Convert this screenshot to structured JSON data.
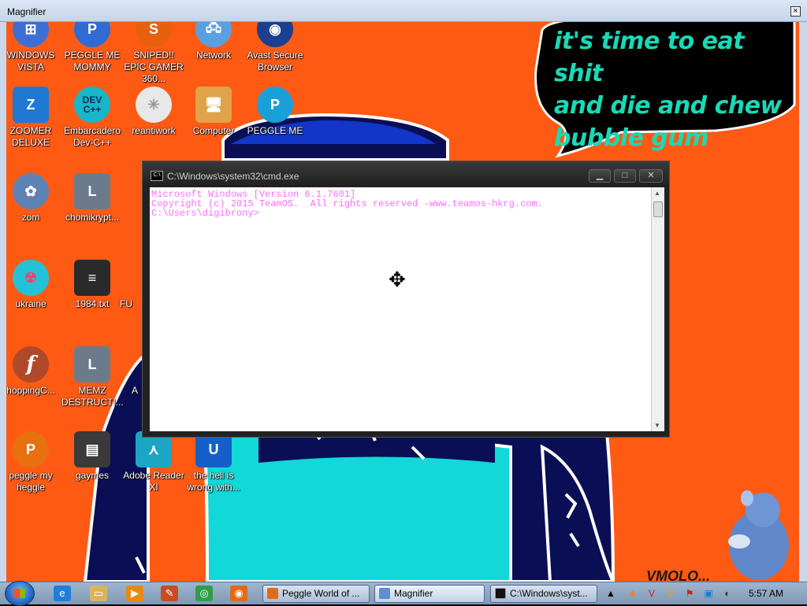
{
  "magnifier": {
    "title": "Magnifier",
    "close_glyph": "×"
  },
  "wallpaper": {
    "speech_lines": [
      "it's time to eat shit",
      "and die and chew",
      "bubble gum"
    ],
    "watermark": "VMOLO..."
  },
  "desktop_icons": [
    {
      "label": "WINDOWS VISTA",
      "icon": "windows-vista-icon",
      "color": "#3c6fd6"
    },
    {
      "label": "PEGGLE ME MOMMY",
      "icon": "peggle-icon",
      "color": "#2f6bd3"
    },
    {
      "label": "SNIPED!! EPIC GAMER 360...",
      "icon": "sniped-icon",
      "color": "#e8600f"
    },
    {
      "label": "Network",
      "icon": "network-icon",
      "color": "#5aa0e0"
    },
    {
      "label": "Avast Secure Browser",
      "icon": "avast-browser-icon",
      "color": "#1c3f8f"
    },
    {
      "label": "ZOOMER DELUXE",
      "icon": "zoomer-deluxe-icon",
      "color": "#1f78d4"
    },
    {
      "label": "Embarcadero Dev-C++",
      "icon": "devcpp-icon",
      "color": "#17b6c8",
      "glyph": "DEV C++"
    },
    {
      "label": "reantiwork",
      "icon": "reantiwork-icon",
      "color": "#e8e8e8"
    },
    {
      "label": "Computer",
      "icon": "computer-icon",
      "color": "#e0a34a"
    },
    {
      "label": "PEGGLE ME",
      "icon": "peggle-me-icon",
      "color": "#1aa0d8"
    },
    {
      "label": "zom",
      "icon": "zom-icon",
      "color": "#5f82b4"
    },
    {
      "label": "chomikrypt...",
      "icon": "chomikrypt-icon",
      "color": "#6b7b8c"
    },
    {
      "label": "ukraine",
      "icon": "radiation-icon",
      "color": "#24c2d8"
    },
    {
      "label": "1984.txt",
      "icon": "text-file-icon",
      "color": "#2a2a2a"
    },
    {
      "label": "FU",
      "icon": "fu-icon",
      "color": "#c0c0c0"
    },
    {
      "label": "hoppingC...",
      "icon": "flash-icon",
      "color": "#b0492a",
      "glyph": "f"
    },
    {
      "label": "MEMZ DESTRUCTI...",
      "icon": "memz-icon",
      "color": "#6b7b8c"
    },
    {
      "label": "A",
      "icon": "partial-icon",
      "color": "#6b7b8c"
    },
    {
      "label": "peggle my heggle",
      "icon": "peggle-heggle-icon",
      "color": "#e8700f"
    },
    {
      "label": "gaymes",
      "icon": "gaymes-folder-icon",
      "color": "#3a3a3a"
    },
    {
      "label": "Adobe Reader XI",
      "icon": "adobe-reader-icon",
      "color": "#1aa6c4"
    },
    {
      "label": "the hell is wrong with...",
      "icon": "uc-browser-icon",
      "color": "#1560c8"
    }
  ],
  "cmd": {
    "title": "C:\\Windows\\system32\\cmd.exe",
    "lines": [
      "Microsoft Windows [Version 6.1.7601]",
      "Copyright (c) 2015 TeamOS.  All rights reserved -www.teamos-hkrg.com.",
      "",
      "C:\\Users\\digibrony>"
    ],
    "minimize_glyph": "▁",
    "maximize_glyph": "□",
    "close_glyph": "✕"
  },
  "taskbar": {
    "tasks": [
      {
        "label": "Peggle World of ...",
        "icon": "peggle-task-icon",
        "active": false
      },
      {
        "label": "Magnifier",
        "icon": "magnifier-task-icon",
        "active": true
      },
      {
        "label": "C:\\Windows\\syst...",
        "icon": "cmd-task-icon",
        "active": false
      }
    ],
    "clock": "5:57 AM"
  }
}
